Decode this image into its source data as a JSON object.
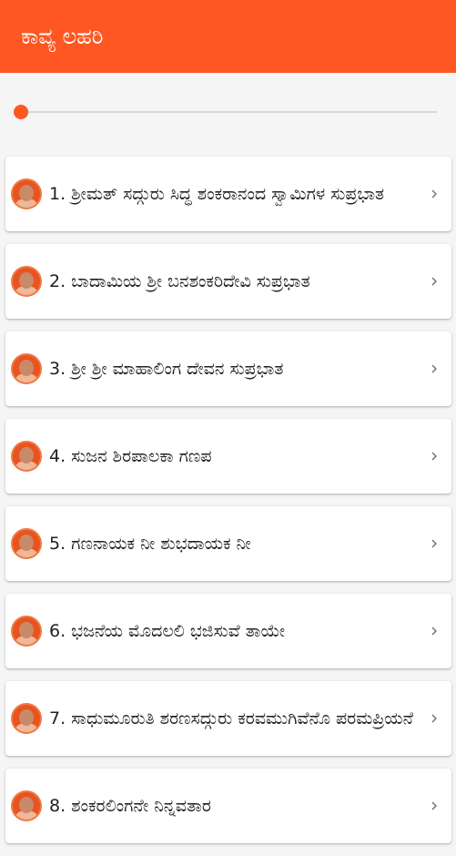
{
  "app_bar": {
    "title": "ಕಾವ್ಯ ಲಹರಿ",
    "color": "#ff5722"
  },
  "player": {
    "progress_percent": 0
  },
  "songs": [
    {
      "label": "1. ಶ್ರೀಮತ್ ಸದ್ಗುರು ಸಿದ್ಧ ಶಂಕರಾನಂದ ಸ್ವಾಮಿಗಳ ಸುಪ್ರಭಾತ"
    },
    {
      "label": "2. ಬಾದಾಮಿಯ ಶ್ರೀ ಬನಶಂಕರಿದೇವಿ ಸುಪ್ರಭಾತ"
    },
    {
      "label": "3. ಶ್ರೀ ಶ್ರೀ ಮಾಹಾಲಿಂಗ ದೇವನ ಸುಪ್ರಭಾತ"
    },
    {
      "label": "4. ಸುಜನ ಶಿರಪಾಲಕಾ ಗಣಪ"
    },
    {
      "label": "5. ಗಣನಾಯಕ ನೀ ಶುಭದಾಯಕ ನೀ"
    },
    {
      "label": "6. ಭಜನೆಯ ಮೊದಲಲಿ ಭಜಿಸುವೆ ತಾಯೇ"
    },
    {
      "label": "7. ಸಾಧುಮೂರುತಿ ಶರಣಸದ್ಗುರು ಕರವಮುಗಿವೆನೊ ಪರಮಪ್ರಿಯನೆ"
    },
    {
      "label": "8. ಶಂಕರಲಿಂಗನೇ ನಿನ್ನವತಾರ"
    }
  ],
  "icons": {
    "item_icon": "avatar-portrait-icon",
    "item_action": "chevron-right-icon"
  }
}
